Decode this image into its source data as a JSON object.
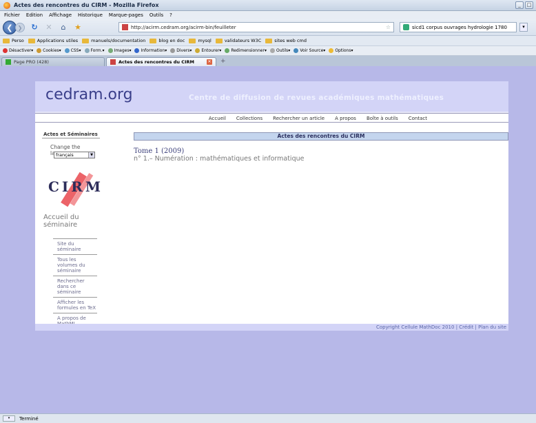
{
  "window": {
    "title": "Actes des rencontres du CIRM - Mozilla Firefox",
    "minimize": "_",
    "maximize": "□",
    "close": "✕"
  },
  "menubar": [
    "Fichier",
    "Edition",
    "Affichage",
    "Historique",
    "Marque-pages",
    "Outils",
    "?"
  ],
  "navbar": {
    "url": "http://acirm.cedram.org/acirm-bin/feuilleter",
    "search": "sicd1 corpus ouvrages hydrologie 1780"
  },
  "bookmarks": [
    "Perso",
    "Applications utiles",
    "manuels/documentation",
    "blog en doc",
    "mysql",
    "validateurs W3C",
    "sites web cmd"
  ],
  "devbar": [
    "Désactiver▾",
    "Cookies▾",
    "CSS▾",
    "Form.▾",
    "Images▾",
    "Information▾",
    "Divers▾",
    "Entourer▾",
    "Redimensionner▾",
    "Outils▾",
    "Voir Source▾",
    "Options▾"
  ],
  "tabs": [
    {
      "label": "Page PRO (428)"
    },
    {
      "label": "Actes des rencontres du CIRM"
    }
  ],
  "site": {
    "logo": "cedram.org",
    "tagline": "Centre de diffusion de revues académiques mathématiques",
    "nav": [
      "Accueil",
      "Collections",
      "Rechercher un article",
      "A propos",
      "Boîte à outils",
      "Contact"
    ],
    "sidebar_title": "Actes et Séminaires",
    "change_language": "Change the language",
    "language_value": "français",
    "cirm_logo_text": "CIRM",
    "home_seminar": "Accueil du séminaire",
    "side_links": [
      "Site du séminaire",
      "Tous les volumes du séminaire",
      "Rechercher dans ce séminaire",
      "Afficher les formules en TeX",
      "A propos de MathML"
    ],
    "main_header": "Actes des rencontres du CIRM",
    "volume": "Tome 1 (2009)",
    "issue": "n° 1.– Numération : mathématiques et informatique",
    "footer": "Copyright Cellule MathDoc 2010 | Crédit | Plan du site"
  },
  "status": {
    "text": "Terminé"
  }
}
